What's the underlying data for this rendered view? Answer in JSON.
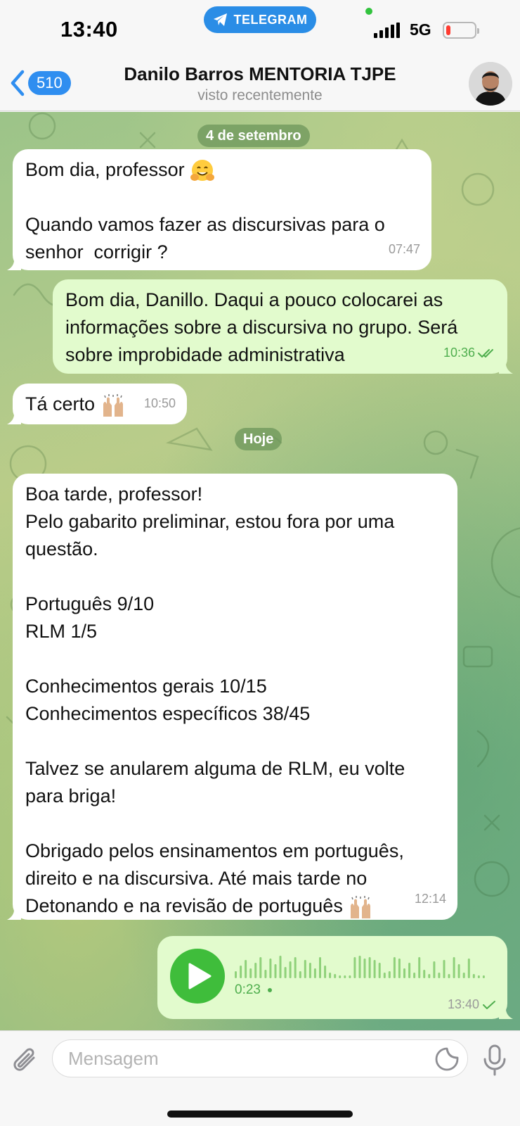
{
  "status_bar": {
    "time": "13:40",
    "app_pill": "TELEGRAM",
    "network": "5G",
    "battery_level": 0.15,
    "battery_color": "#ff3b30"
  },
  "header": {
    "back_count": "510",
    "title": "Danilo Barros MENTORIA TJPE",
    "subtitle": "visto recentemente"
  },
  "messages": {
    "date_1": "4 de setembro",
    "m1": {
      "text": "Bom dia, professor ",
      "emoji": "hugging-face-emoji",
      "text2": "\n\nQuando vamos fazer as discursivas para o\nsenhor  corrigir ?",
      "time": "07:47"
    },
    "m2": {
      "text": "Bom dia, Danillo. Daqui a pouco colocarei as\ninformações sobre a discursiva no grupo. Será\nsobre improbidade administrativa",
      "time": "10:36",
      "status": "read"
    },
    "m3": {
      "text": "Tá certo ",
      "emoji": "raising-hands-emoji",
      "time": "10:50"
    },
    "date_2": "Hoje",
    "m4": {
      "text": "Boa tarde, professor!\nPelo gabarito preliminar, estou fora por uma\nquestão.\n\nPortuguês 9/10\nRLM 1/5\n\nConhecimentos gerais 10/15\nConhecimentos específicos 38/45\n\nTalvez se anularem alguma de RLM, eu volte\npara briga!\n\nObrigado pelos ensinamentos em português,\ndireito e na discursiva. Até mais tarde no\nDetonando e na revisão de português ",
      "emoji": "raising-hands-emoji",
      "time": "12:14"
    },
    "voice": {
      "duration": "0:23",
      "time": "13:40",
      "status": "sent"
    }
  },
  "input": {
    "placeholder": "Mensagem"
  },
  "colors": {
    "accent": "#2f8ef0",
    "outgoing_bubble": "#e2fbcd",
    "play_button": "#3fbd3b"
  }
}
